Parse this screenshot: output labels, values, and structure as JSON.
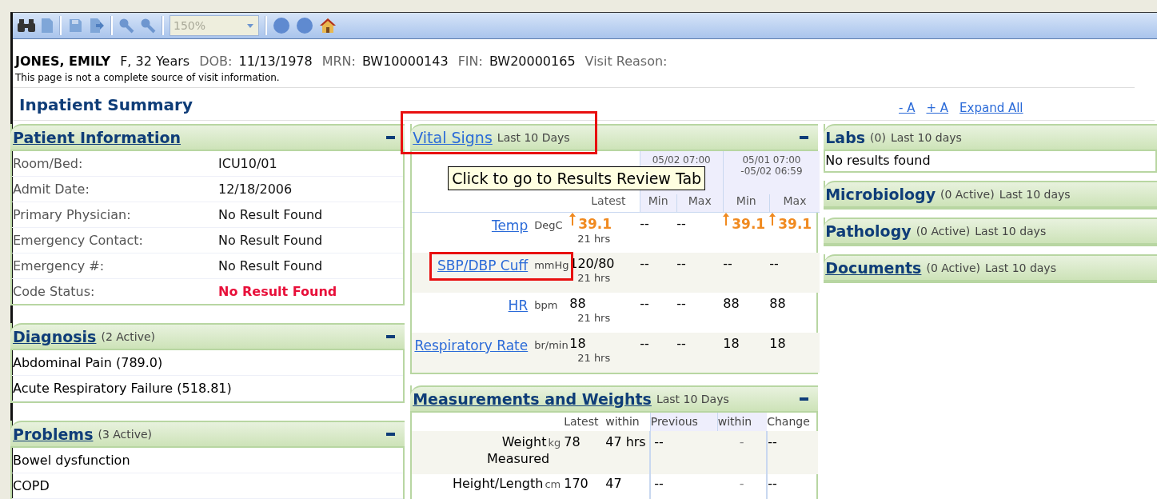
{
  "toolbar": {
    "zoom": "150%"
  },
  "patient": {
    "name": "JONES, EMILY",
    "sex_age": "F, 32 Years",
    "fields": [
      {
        "label": "DOB:",
        "value": "11/13/1978"
      },
      {
        "label": "MRN:",
        "value": "BW10000143"
      },
      {
        "label": "FIN:",
        "value": "BW20000165"
      },
      {
        "label": "Visit Reason:"
      }
    ],
    "disclaimer": "This page is not a complete source of visit information."
  },
  "page_title": "Inpatient Summary",
  "page_links": [
    "- A",
    "+ A",
    "Expand All"
  ],
  "patient_information": {
    "title": "Patient Information",
    "rows": [
      {
        "label": "Room/Bed:",
        "value": "ICU10/01",
        "alert": false
      },
      {
        "label": "Admit Date:",
        "value": "12/18/2006",
        "alert": false
      },
      {
        "label": "Primary Physician:",
        "value": "No Result Found",
        "alert": false
      },
      {
        "label": "Emergency Contact:",
        "value": "No Result Found",
        "alert": false
      },
      {
        "label": "Emergency #:",
        "value": "No Result Found",
        "alert": false
      },
      {
        "label": "Code Status:",
        "value": "No Result Found",
        "alert": true
      }
    ]
  },
  "diagnosis": {
    "title": "Diagnosis",
    "count": "(2 Active)",
    "items": [
      "Abdominal Pain (789.0)",
      "Acute Respiratory Failure (518.81)"
    ]
  },
  "problems": {
    "title": "Problems",
    "count": "(3 Active)",
    "items": [
      "Bowel dysfunction",
      "COPD"
    ]
  },
  "vital_signs": {
    "title": "Vital Signs",
    "subtitle": "Last 10 Days",
    "highlighted": true,
    "ranges": [
      [
        "05/02 07:00"
      ],
      [
        "05/01 07:00",
        "-05/02 06:59"
      ]
    ],
    "columns": [
      "Latest",
      "Min",
      "Max",
      "Min",
      "Max"
    ],
    "tooltip": "Click to go to Results Review Tab",
    "rows": [
      {
        "name": "Temp",
        "unit": "DegC",
        "highlighted": false,
        "cells": [
          {
            "value": "39.1",
            "age": "21 hrs",
            "high": true
          },
          {
            "value": "--",
            "high": false
          },
          {
            "value": "--",
            "high": false
          },
          {
            "value": "39.1",
            "high": true
          },
          {
            "value": "39.1",
            "high": true
          }
        ]
      },
      {
        "name": "SBP/DBP Cuff",
        "unit": "mmHg",
        "highlighted": true,
        "cells": [
          {
            "value": "120/80",
            "age": "21 hrs",
            "high": false
          },
          {
            "value": "--",
            "high": false
          },
          {
            "value": "--",
            "high": false
          },
          {
            "value": "--",
            "high": false
          },
          {
            "value": "--",
            "high": false
          }
        ]
      },
      {
        "name": "HR",
        "unit": "bpm",
        "highlighted": false,
        "cells": [
          {
            "value": "88",
            "age": "21 hrs",
            "high": false
          },
          {
            "value": "--",
            "high": false
          },
          {
            "value": "--",
            "high": false
          },
          {
            "value": "88",
            "high": false
          },
          {
            "value": "88",
            "high": false
          }
        ]
      },
      {
        "name": "Respiratory Rate",
        "unit": "br/min",
        "highlighted": false,
        "cells": [
          {
            "value": "18",
            "age": "21 hrs",
            "high": false
          },
          {
            "value": "--",
            "high": false
          },
          {
            "value": "--",
            "high": false
          },
          {
            "value": "18",
            "high": false
          },
          {
            "value": "18",
            "high": false
          }
        ]
      }
    ]
  },
  "measurements": {
    "title": "Measurements and Weights",
    "subtitle": "Last 10 Days",
    "columns": [
      "Latest",
      "within",
      "Previous",
      "within",
      "Change"
    ],
    "rows": [
      {
        "name": "Weight",
        "unit": "kg",
        "name_line2": "Measured",
        "latest": "78",
        "within": "47 hrs",
        "previous": "--",
        "previous_within": "-",
        "change": "--"
      },
      {
        "name": "Height/Length",
        "unit": "cm",
        "latest": "170",
        "within": "47",
        "previous": "--",
        "previous_within": "-",
        "change": "--"
      }
    ]
  },
  "right_panels": [
    {
      "title": "Labs",
      "link": false,
      "count": "(0)",
      "subtitle": "Last 10 days",
      "body": "No results found"
    },
    {
      "title": "Microbiology",
      "link": false,
      "count": "(0 Active)",
      "subtitle": "Last 10 days"
    },
    {
      "title": "Pathology",
      "link": false,
      "count": "(0 Active)",
      "subtitle": "Last 10 days"
    },
    {
      "title": "Documents",
      "link": true,
      "count": "(0 Active)",
      "subtitle": "Last 10 days"
    }
  ]
}
